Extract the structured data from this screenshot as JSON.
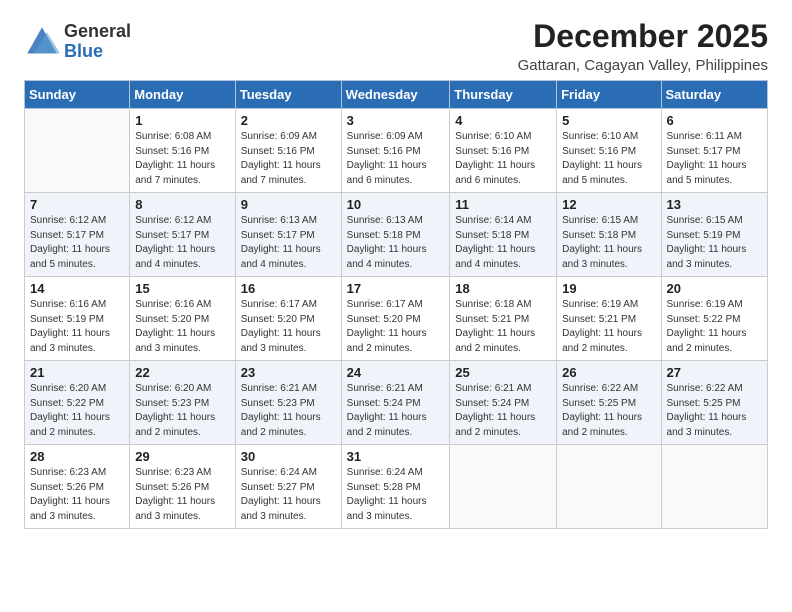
{
  "logo": {
    "general": "General",
    "blue": "Blue"
  },
  "header": {
    "month": "December 2025",
    "subtitle": "Gattaran, Cagayan Valley, Philippines"
  },
  "weekdays": [
    "Sunday",
    "Monday",
    "Tuesday",
    "Wednesday",
    "Thursday",
    "Friday",
    "Saturday"
  ],
  "weeks": [
    [
      {
        "day": "",
        "empty": true
      },
      {
        "day": "1",
        "sunrise": "6:08 AM",
        "sunset": "5:16 PM",
        "daylight": "11 hours and 7 minutes."
      },
      {
        "day": "2",
        "sunrise": "6:09 AM",
        "sunset": "5:16 PM",
        "daylight": "11 hours and 7 minutes."
      },
      {
        "day": "3",
        "sunrise": "6:09 AM",
        "sunset": "5:16 PM",
        "daylight": "11 hours and 6 minutes."
      },
      {
        "day": "4",
        "sunrise": "6:10 AM",
        "sunset": "5:16 PM",
        "daylight": "11 hours and 6 minutes."
      },
      {
        "day": "5",
        "sunrise": "6:10 AM",
        "sunset": "5:16 PM",
        "daylight": "11 hours and 5 minutes."
      },
      {
        "day": "6",
        "sunrise": "6:11 AM",
        "sunset": "5:17 PM",
        "daylight": "11 hours and 5 minutes."
      }
    ],
    [
      {
        "day": "7",
        "sunrise": "6:12 AM",
        "sunset": "5:17 PM",
        "daylight": "11 hours and 5 minutes."
      },
      {
        "day": "8",
        "sunrise": "6:12 AM",
        "sunset": "5:17 PM",
        "daylight": "11 hours and 4 minutes."
      },
      {
        "day": "9",
        "sunrise": "6:13 AM",
        "sunset": "5:17 PM",
        "daylight": "11 hours and 4 minutes."
      },
      {
        "day": "10",
        "sunrise": "6:13 AM",
        "sunset": "5:18 PM",
        "daylight": "11 hours and 4 minutes."
      },
      {
        "day": "11",
        "sunrise": "6:14 AM",
        "sunset": "5:18 PM",
        "daylight": "11 hours and 4 minutes."
      },
      {
        "day": "12",
        "sunrise": "6:15 AM",
        "sunset": "5:18 PM",
        "daylight": "11 hours and 3 minutes."
      },
      {
        "day": "13",
        "sunrise": "6:15 AM",
        "sunset": "5:19 PM",
        "daylight": "11 hours and 3 minutes."
      }
    ],
    [
      {
        "day": "14",
        "sunrise": "6:16 AM",
        "sunset": "5:19 PM",
        "daylight": "11 hours and 3 minutes."
      },
      {
        "day": "15",
        "sunrise": "6:16 AM",
        "sunset": "5:20 PM",
        "daylight": "11 hours and 3 minutes."
      },
      {
        "day": "16",
        "sunrise": "6:17 AM",
        "sunset": "5:20 PM",
        "daylight": "11 hours and 3 minutes."
      },
      {
        "day": "17",
        "sunrise": "6:17 AM",
        "sunset": "5:20 PM",
        "daylight": "11 hours and 2 minutes."
      },
      {
        "day": "18",
        "sunrise": "6:18 AM",
        "sunset": "5:21 PM",
        "daylight": "11 hours and 2 minutes."
      },
      {
        "day": "19",
        "sunrise": "6:19 AM",
        "sunset": "5:21 PM",
        "daylight": "11 hours and 2 minutes."
      },
      {
        "day": "20",
        "sunrise": "6:19 AM",
        "sunset": "5:22 PM",
        "daylight": "11 hours and 2 minutes."
      }
    ],
    [
      {
        "day": "21",
        "sunrise": "6:20 AM",
        "sunset": "5:22 PM",
        "daylight": "11 hours and 2 minutes."
      },
      {
        "day": "22",
        "sunrise": "6:20 AM",
        "sunset": "5:23 PM",
        "daylight": "11 hours and 2 minutes."
      },
      {
        "day": "23",
        "sunrise": "6:21 AM",
        "sunset": "5:23 PM",
        "daylight": "11 hours and 2 minutes."
      },
      {
        "day": "24",
        "sunrise": "6:21 AM",
        "sunset": "5:24 PM",
        "daylight": "11 hours and 2 minutes."
      },
      {
        "day": "25",
        "sunrise": "6:21 AM",
        "sunset": "5:24 PM",
        "daylight": "11 hours and 2 minutes."
      },
      {
        "day": "26",
        "sunrise": "6:22 AM",
        "sunset": "5:25 PM",
        "daylight": "11 hours and 2 minutes."
      },
      {
        "day": "27",
        "sunrise": "6:22 AM",
        "sunset": "5:25 PM",
        "daylight": "11 hours and 3 minutes."
      }
    ],
    [
      {
        "day": "28",
        "sunrise": "6:23 AM",
        "sunset": "5:26 PM",
        "daylight": "11 hours and 3 minutes."
      },
      {
        "day": "29",
        "sunrise": "6:23 AM",
        "sunset": "5:26 PM",
        "daylight": "11 hours and 3 minutes."
      },
      {
        "day": "30",
        "sunrise": "6:24 AM",
        "sunset": "5:27 PM",
        "daylight": "11 hours and 3 minutes."
      },
      {
        "day": "31",
        "sunrise": "6:24 AM",
        "sunset": "5:28 PM",
        "daylight": "11 hours and 3 minutes."
      },
      {
        "day": "",
        "empty": true
      },
      {
        "day": "",
        "empty": true
      },
      {
        "day": "",
        "empty": true
      }
    ]
  ]
}
